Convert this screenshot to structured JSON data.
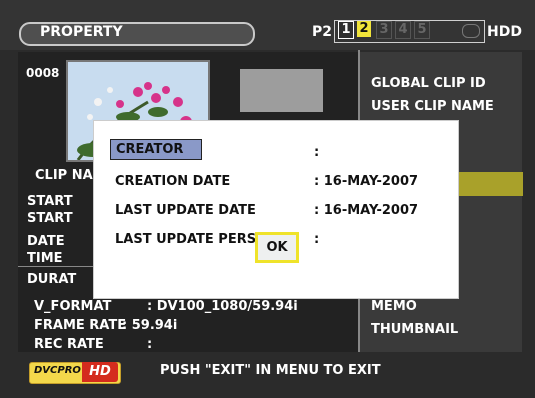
{
  "header": {
    "title": "PROPERTY",
    "p2_label": "P2",
    "slots": [
      "1",
      "2",
      "3",
      "4",
      "5"
    ],
    "hdd_label": "HDD",
    "colors": {
      "slot1": "#ffffff",
      "slot2_bg": "#f1e43a",
      "slot_inactive": "#3a3a3a"
    }
  },
  "clip": {
    "number": "0008",
    "left_labels": [
      "CLIP NA",
      "START",
      "START",
      "DATE",
      "TIME",
      "DURAT"
    ],
    "v_format_label": "V_FORMAT",
    "v_format_value": ": DV100_1080/59.94i",
    "frame_rate_label": "FRAME RATE",
    "frame_rate_value": ": 59.94i",
    "rec_rate_label": "REC RATE",
    "rec_rate_value": ":"
  },
  "right_menu": {
    "items": [
      "GLOBAL CLIP ID",
      "USER CLIP NAME",
      "MEMO",
      "THUMBNAIL"
    ]
  },
  "dialog": {
    "creator_label": "CREATOR",
    "creator_value": ":",
    "rows": [
      {
        "label": "CREATION DATE",
        "value": ":   16-MAY-2007"
      },
      {
        "label": "LAST UPDATE DATE",
        "value": ":   16-MAY-2007"
      },
      {
        "label": "LAST UPDATE PERSON",
        "value": ":"
      }
    ],
    "ok_label": "OK"
  },
  "footer": {
    "badge_left": "DVCPRO",
    "badge_right": "HD",
    "message": "PUSH \"EXIT\" IN MENU TO EXIT"
  }
}
